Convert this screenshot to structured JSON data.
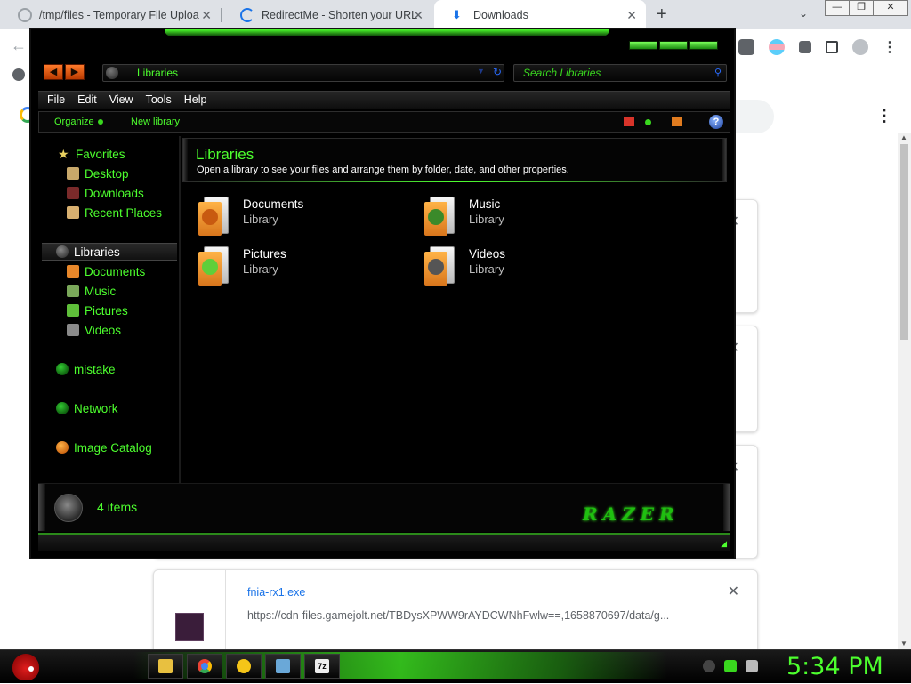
{
  "browser": {
    "tabs": [
      {
        "title": "/tmp/files - Temporary File Uploa"
      },
      {
        "title": "RedirectMe - Shorten your URL to"
      },
      {
        "title": "Downloads"
      }
    ],
    "new_tab": "+",
    "window_buttons": [
      "—",
      "❐",
      "✕"
    ],
    "downloads": {
      "last_item": {
        "file_name": "fnia-rx1.exe",
        "url": "https://cdn-files.gamejolt.net/TBDysXPWW9rAYDCWNhFwlw==,1658870697/data/g..."
      }
    }
  },
  "explorer": {
    "address": "Libraries",
    "search_placeholder": "Search Libraries",
    "menu": [
      "File",
      "Edit",
      "View",
      "Tools",
      "Help"
    ],
    "commands": {
      "organize": "Organize",
      "new_library": "New library"
    },
    "nav": {
      "favorites": "Favorites",
      "favorites_items": [
        "Desktop",
        "Downloads",
        "Recent Places"
      ],
      "libraries": "Libraries",
      "libraries_items": [
        "Documents",
        "Music",
        "Pictures",
        "Videos"
      ],
      "user": "mistake",
      "network": "Network",
      "image_catalog": "Image Catalog"
    },
    "header": {
      "title": "Libraries",
      "subtitle": "Open a library to see your files and arrange them by folder, date, and other properties."
    },
    "libraries": [
      {
        "name": "Documents",
        "type": "Library"
      },
      {
        "name": "Music",
        "type": "Library"
      },
      {
        "name": "Pictures",
        "type": "Library"
      },
      {
        "name": "Videos",
        "type": "Library"
      }
    ],
    "details": {
      "count": "4 items"
    },
    "brand": "RAZER"
  },
  "taskbar": {
    "clock": "5:34 PM"
  },
  "colors": {
    "razer_green": "#4dff2e",
    "chrome_tabbar": "#dee1e6",
    "link_blue": "#1a73e8"
  }
}
